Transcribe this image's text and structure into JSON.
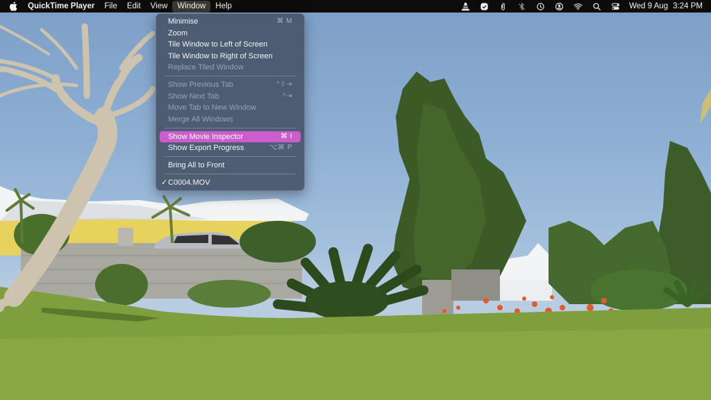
{
  "menubar": {
    "apple_icon": "apple-logo",
    "app_name": "QuickTime Player",
    "menus": [
      {
        "label": "File"
      },
      {
        "label": "Edit"
      },
      {
        "label": "View"
      },
      {
        "label": "Window",
        "active": true
      },
      {
        "label": "Help"
      }
    ],
    "status_icons": [
      "vlc-cone-icon",
      "checkmark-badge-icon",
      "paperclip-icon",
      "bluetooth-off-icon",
      "time-machine-icon",
      "user-account-icon",
      "wifi-icon",
      "spotlight-search-icon",
      "control-center-icon"
    ],
    "date": "Wed 9 Aug",
    "time": "3:24 PM"
  },
  "window_menu": {
    "groups": [
      [
        {
          "label": "Minimise",
          "shortcut": "⌘ M",
          "enabled": true
        },
        {
          "label": "Zoom",
          "shortcut": "",
          "enabled": true
        },
        {
          "label": "Tile Window to Left of Screen",
          "shortcut": "",
          "enabled": true
        },
        {
          "label": "Tile Window to Right of Screen",
          "shortcut": "",
          "enabled": true
        },
        {
          "label": "Replace Tiled Window",
          "shortcut": "",
          "enabled": false
        }
      ],
      [
        {
          "label": "Show Previous Tab",
          "shortcut": "^⇧⇥",
          "enabled": false
        },
        {
          "label": "Show Next Tab",
          "shortcut": "^⇥",
          "enabled": false
        },
        {
          "label": "Move Tab to New Window",
          "shortcut": "",
          "enabled": false
        },
        {
          "label": "Merge All Windows",
          "shortcut": "",
          "enabled": false
        }
      ],
      [
        {
          "label": "Show Movie Inspector",
          "shortcut": "⌘ I",
          "enabled": true,
          "highlighted": true
        },
        {
          "label": "Show Export Progress",
          "shortcut": "⌥⌘ P",
          "enabled": true
        }
      ],
      [
        {
          "label": "Bring All to Front",
          "shortcut": "",
          "enabled": true
        }
      ],
      [
        {
          "label": "C0004.MOV",
          "shortcut": "",
          "enabled": true,
          "checked": true,
          "check_mark": "✓"
        }
      ]
    ]
  },
  "colors": {
    "menu_highlight": "#cc5dcf",
    "menu_background": "#49566c",
    "menubar_background": "#0d0c0b"
  },
  "video_frame": {
    "description": "Garden scene: bare tree left, yellow house with white roof, stone wall, silver car, tall cypress trees, cycad palm, orange flowers, green lawn"
  }
}
